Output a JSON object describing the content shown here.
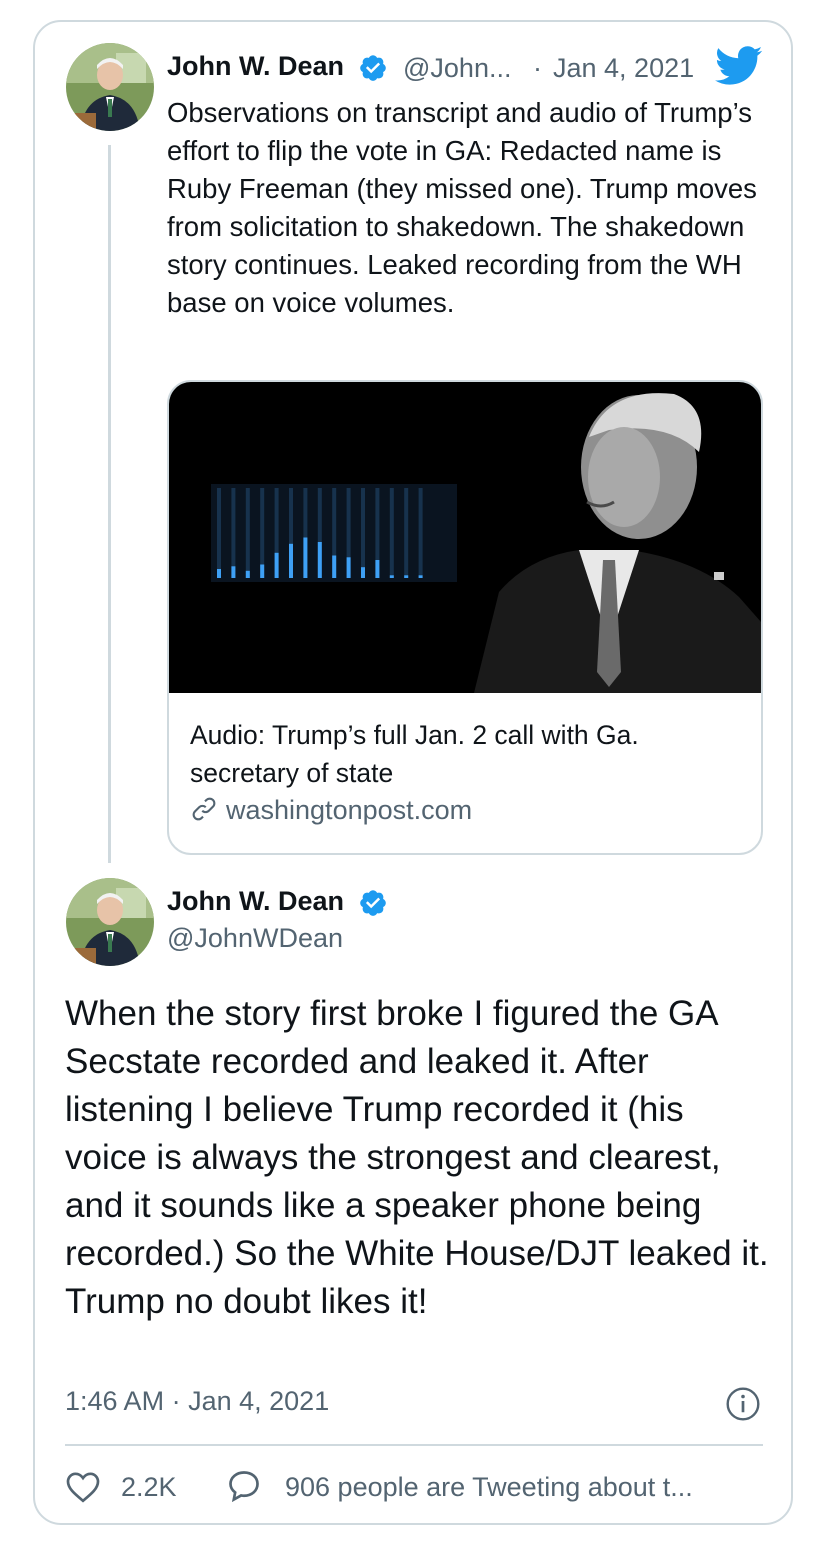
{
  "quoted_tweet": {
    "author_name": "John W. Dean",
    "handle": "@John...",
    "separator": "·",
    "date": "Jan 4, 2021",
    "text": "Observations on transcript and audio of Trump’s effort to flip the vote in GA: Redacted name is Ruby Freeman (they missed one). Trump moves from solicitation to shakedown. The shakedown story continues. Leaked recording from the WH base on voice volumes.",
    "link_card": {
      "title": "Audio: Trump’s full Jan. 2 call with Ga. secretary of state",
      "domain": "washingtonpost.com",
      "audio_levels": [
        0.1,
        0.13,
        0.08,
        0.15,
        0.28,
        0.38,
        0.45,
        0.4,
        0.25,
        0.23,
        0.12,
        0.2,
        0.03,
        0.03,
        0.03
      ]
    }
  },
  "main_tweet": {
    "author_name": "John W. Dean",
    "handle": "@JohnWDean",
    "text": "When the story first broke I figured the GA Secstate recorded and leaked it. After listening I believe Trump recorded it (his voice is always the strongest and clearest, and it sounds like a speaker phone being recorded.) So the White House/DJT leaked it. Trump no doubt likes it!",
    "time": "1:46 AM",
    "separator": "·",
    "date": "Jan 4, 2021"
  },
  "actions": {
    "likes": "2.2K",
    "tweeting_about": "906 people are Tweeting about t..."
  },
  "colors": {
    "verified": "#1d9bf0",
    "twitter_blue": "#1d9bf0",
    "secondary_text": "#536471",
    "border": "#cfd9de"
  },
  "icons": [
    "twitter-bird-icon",
    "verified-badge-icon",
    "link-icon",
    "info-icon",
    "heart-icon",
    "reply-bubble-icon"
  ]
}
